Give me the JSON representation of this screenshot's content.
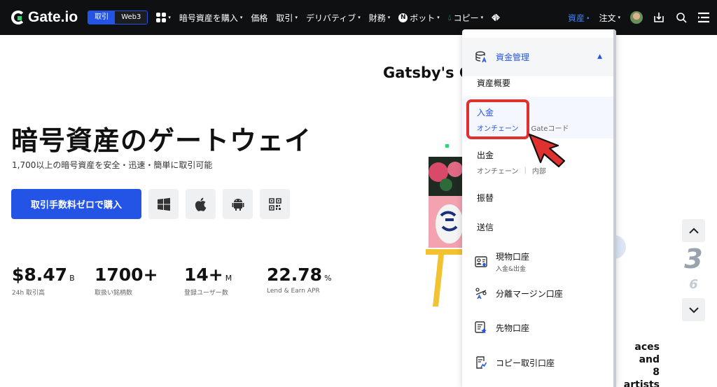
{
  "nav": {
    "logo": "Gate.io",
    "switch": [
      "取引",
      "Web3"
    ],
    "items": [
      {
        "label": "",
        "caret": "▾"
      },
      {
        "label": "暗号資産を購入",
        "caret": "▾"
      },
      {
        "label": "価格",
        "caret": ""
      },
      {
        "label": "取引",
        "caret": "▾"
      },
      {
        "label": "デリバティブ",
        "caret": "▾"
      },
      {
        "label": "財務",
        "caret": "▾"
      },
      {
        "label": "ボット",
        "caret": "▾"
      },
      {
        "label": "コピー",
        "caret": "▾"
      }
    ],
    "n_badge": "N",
    "right": {
      "assets": "資産",
      "assets_caret": "▴",
      "orders": "注文",
      "orders_caret": "▾"
    }
  },
  "hero": {
    "title": "暗号資産のゲートウェイ",
    "subtitle": "1,700以上の暗号資産を安全・迅速・簡単に取引可能",
    "buy_button": "取引手数料ゼロで購入",
    "stats": [
      {
        "value": "$8.47",
        "unit": "B",
        "label": "24h 取引高"
      },
      {
        "value": "1700+",
        "unit": "",
        "label": "取扱い銘柄数"
      },
      {
        "value": "14+",
        "unit": "M",
        "label": "登録ユーザー数"
      },
      {
        "value": "22.78",
        "unit": "%",
        "label": "Lend & Earn APR"
      }
    ]
  },
  "banner": {
    "title": "Gatsby's C",
    "side_text": [
      "aces and",
      "8 artists"
    ],
    "page_current": "3",
    "page_total": "6"
  },
  "dropdown": {
    "header": "資金管理",
    "overview": "資産概要",
    "deposit": {
      "title": "入金",
      "onchain": "オンチェーン",
      "gatecode": "Gateコード"
    },
    "withdraw": {
      "title": "出金",
      "onchain": "オンチェーン",
      "internal": "内部"
    },
    "transfer": "振替",
    "send": "送信",
    "accounts": [
      {
        "title": "現物口座",
        "sub": "入金&出金"
      },
      {
        "title": "分離マージン口座",
        "sub": ""
      },
      {
        "title": "先物口座",
        "sub": ""
      },
      {
        "title": "コピー取引口座",
        "sub": ""
      }
    ]
  },
  "colors": {
    "brand": "#2354e6",
    "nav_bg": "#0f1012",
    "accent_green": "#2ed673",
    "highlight_red": "#e03131"
  }
}
